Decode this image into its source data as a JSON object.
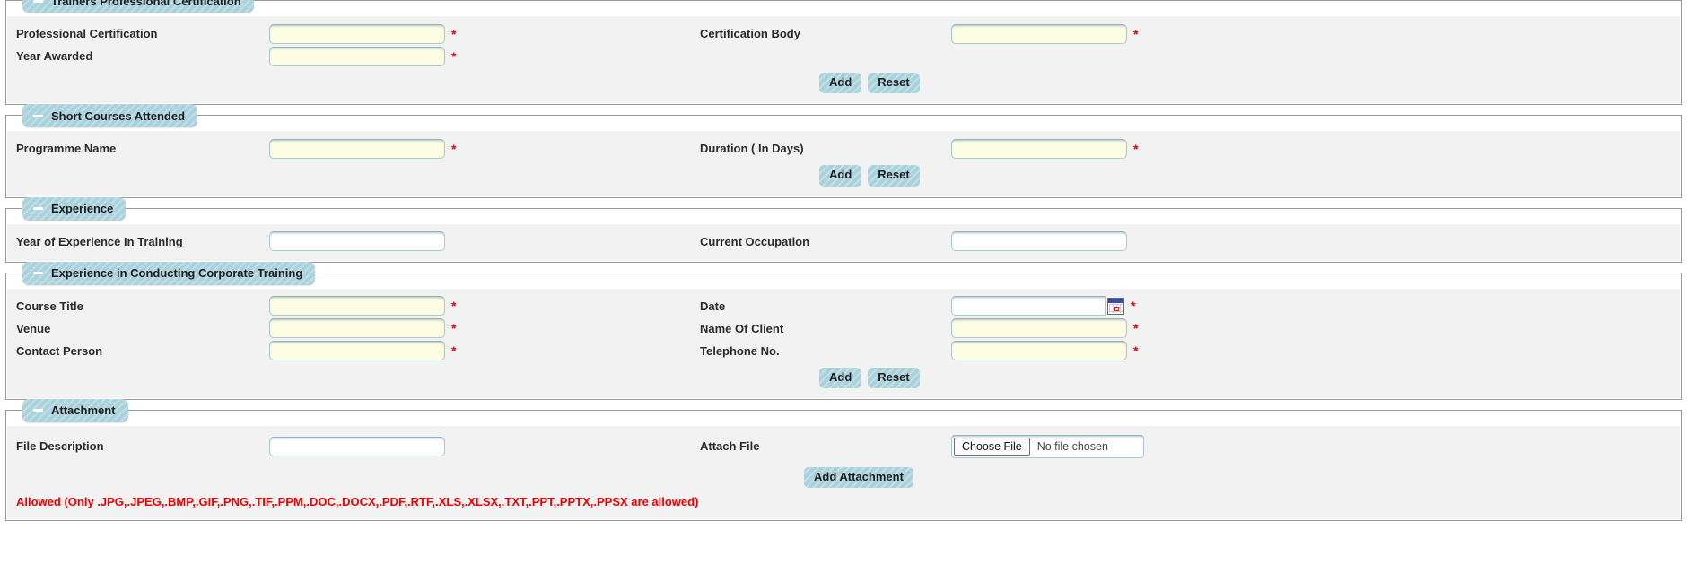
{
  "colors": {
    "legend_bg": "#a9d2dc",
    "panel_bg": "#f2f2f2",
    "required_field_bg": "#fdfde4",
    "required_star": "#e8000d",
    "note_red": "#ee0000",
    "border_gray": "#9a9a9a",
    "input_border": "#a8c8d2"
  },
  "sections": {
    "certification": {
      "legend": "Trainers Professional Certification",
      "collapse_icon": "minus-icon",
      "fields": {
        "professional_certification": {
          "label": "Professional Certification",
          "value": "",
          "required_marker": "*"
        },
        "certification_body": {
          "label": "Certification Body",
          "value": "",
          "required_marker": "*"
        },
        "year_awarded": {
          "label": "Year Awarded",
          "value": "",
          "required_marker": "*"
        }
      },
      "buttons": {
        "add": "Add",
        "reset": "Reset"
      }
    },
    "short_courses": {
      "legend": "Short Courses Attended",
      "collapse_icon": "minus-icon",
      "fields": {
        "programme_name": {
          "label": "Programme Name",
          "value": "",
          "required_marker": "*"
        },
        "duration": {
          "label": "Duration ( In Days)",
          "value": "",
          "required_marker": "*"
        }
      },
      "buttons": {
        "add": "Add",
        "reset": "Reset"
      }
    },
    "experience": {
      "legend": "Experience",
      "collapse_icon": "minus-icon",
      "fields": {
        "years_experience": {
          "label": "Year of Experience In Training",
          "value": ""
        },
        "current_occupation": {
          "label": "Current Occupation",
          "value": ""
        }
      }
    },
    "corporate_training": {
      "legend": "Experience in Conducting Corporate Training",
      "collapse_icon": "minus-icon",
      "fields": {
        "course_title": {
          "label": "Course Title",
          "value": "",
          "required_marker": "*"
        },
        "date": {
          "label": "Date",
          "value": "",
          "required_marker": "*",
          "picker_icon": "calendar-icon"
        },
        "venue": {
          "label": "Venue",
          "value": "",
          "required_marker": "*"
        },
        "name_of_client": {
          "label": "Name Of Client",
          "value": "",
          "required_marker": "*"
        },
        "contact_person": {
          "label": "Contact Person",
          "value": "",
          "required_marker": "*"
        },
        "telephone_no": {
          "label": "Telephone No.",
          "value": "",
          "required_marker": "*"
        }
      },
      "buttons": {
        "add": "Add",
        "reset": "Reset"
      }
    },
    "attachment": {
      "legend": "Attachment",
      "collapse_icon": "minus-icon",
      "fields": {
        "file_description": {
          "label": "File Description",
          "value": ""
        },
        "attach_file": {
          "label": "Attach File",
          "choose_button": "Choose File",
          "file_status": "No file chosen"
        }
      },
      "buttons": {
        "add_attachment": "Add Attachment"
      },
      "allowed_note": "Allowed (Only .JPG,.JPEG,.BMP,.GIF,.PNG,.TIF,.PPM,.DOC,.DOCX,.PDF,.RTF,.XLS,.XLSX,.TXT,.PPT,.PPTX,.PPSX are allowed)"
    }
  }
}
